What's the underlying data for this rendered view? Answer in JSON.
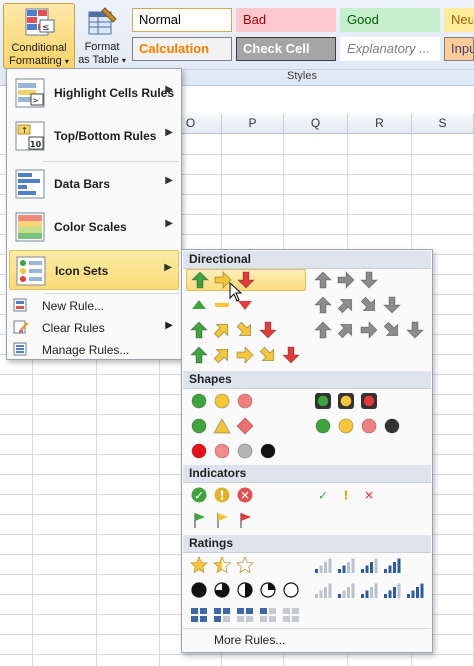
{
  "ribbon": {
    "conditional_formatting": {
      "line1": "Conditional",
      "line2": "Formatting"
    },
    "format_as_table": {
      "line1": "Format",
      "line2": "as Table"
    },
    "styles_group_label": "Styles",
    "cell_styles": [
      {
        "label": "Normal",
        "bg": "#ffffff",
        "fg": "#000000",
        "border": "#c9a952"
      },
      {
        "label": "Bad",
        "bg": "#ffc7ce",
        "fg": "#9c0006",
        "border": "#ffc7ce"
      },
      {
        "label": "Good",
        "bg": "#c6efce",
        "fg": "#006100",
        "border": "#c6efce"
      },
      {
        "label": "Neu",
        "bg": "#ffeb9c",
        "fg": "#9c6500",
        "border": "#ffeb9c"
      },
      {
        "label": "Calculation",
        "bg": "#f2f2f2",
        "fg": "#fa7d00",
        "border": "#7f7f7f"
      },
      {
        "label": "Check Cell",
        "bg": "#a5a5a5",
        "fg": "#ffffff",
        "border": "#3f3f3f"
      },
      {
        "label": "Explanatory ...",
        "bg": "#ffffff",
        "fg": "#7f7f7f",
        "border": "#ffffff"
      },
      {
        "label": "Inpu",
        "bg": "#ffcc99",
        "fg": "#3f3f76",
        "border": "#7f7f7f"
      }
    ]
  },
  "sheet": {
    "columns": [
      "O",
      "P",
      "Q",
      "R",
      "S"
    ]
  },
  "menu": {
    "items": [
      {
        "label": "Highlight Cells Rules",
        "icon": "highlight-cells-icon"
      },
      {
        "label": "Top/Bottom Rules",
        "icon": "top-bottom-icon"
      },
      {
        "label": "Data Bars",
        "icon": "data-bars-icon"
      },
      {
        "label": "Color Scales",
        "icon": "color-scales-icon"
      },
      {
        "label": "Icon Sets",
        "icon": "icon-sets-icon"
      }
    ],
    "small_items": [
      {
        "label": "New Rule...",
        "icon": "new-rule-icon"
      },
      {
        "label": "Clear Rules",
        "icon": "clear-rules-icon"
      },
      {
        "label": "Manage Rules...",
        "icon": "manage-rules-icon"
      }
    ]
  },
  "submenu": {
    "sections": [
      "Directional",
      "Shapes",
      "Indicators",
      "Ratings"
    ],
    "more_rules": "More Rules..."
  },
  "colors": {
    "green": "#3fa33f",
    "yellow": "#f5c63a",
    "red": "#e03c3c",
    "gray": "#8c8c8c",
    "highlight": "#fbdb77"
  }
}
